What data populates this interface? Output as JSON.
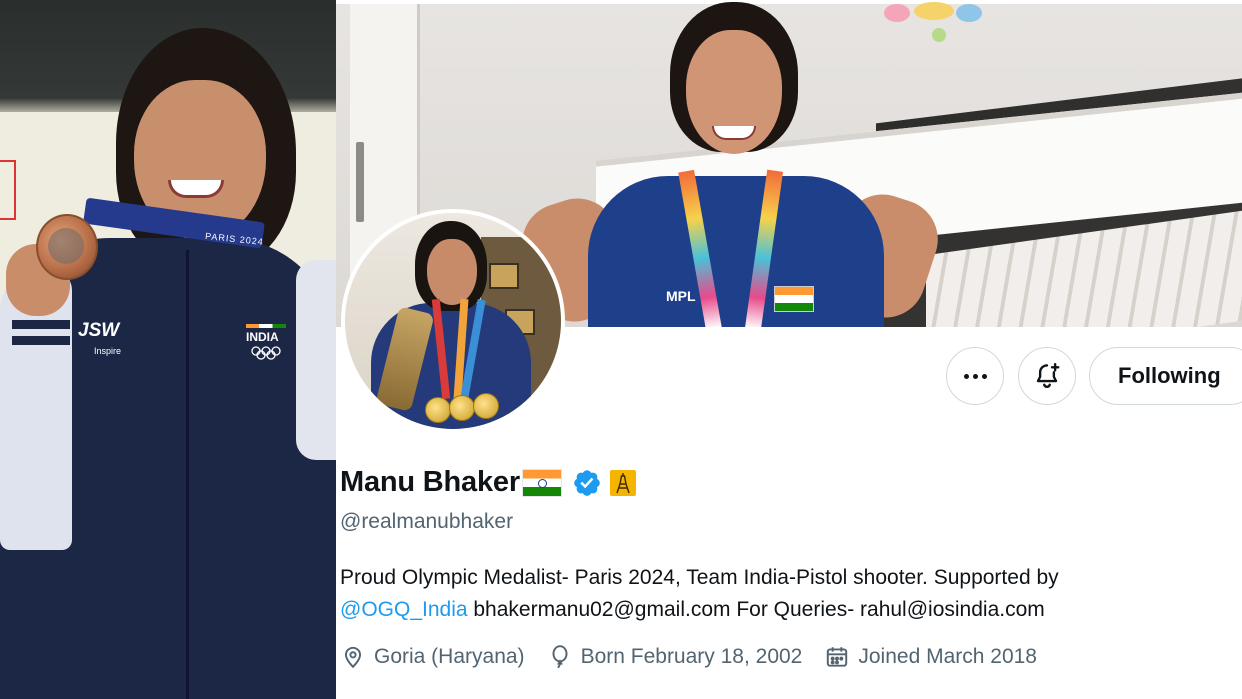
{
  "profile": {
    "name": "Manu Bhaker",
    "handle": "@realmanubhaker",
    "bio_text": "Proud Olympic Medalist- Paris 2024, Team India-Pistol shooter. Supported by",
    "bio_link": "@OGQ_India",
    "bio_text_after": " bhakermanu02@gmail.com For Queries- rahul@iosindia.com",
    "location": "Goria (Haryana)",
    "birthday": "Born February 18, 2002",
    "joined": "Joined March 2018"
  },
  "actions": {
    "following_label": "Following"
  },
  "photo": {
    "jacket_brand": "JSW",
    "jacket_brand_sub": "Inspire",
    "jacket_badge": "INDIA",
    "ribbon_text": "PARIS 2024",
    "banner_jersey_text": "MPL"
  },
  "icons": {
    "more": "more-horizontal-icon",
    "notify": "bell-plus-icon",
    "verified": "verified-badge-icon",
    "affiliate": "eiffel-tower-icon",
    "location": "map-pin-icon",
    "birthday": "balloon-icon",
    "joined": "calendar-icon"
  },
  "colors": {
    "accent": "#1d9bf0",
    "text_primary": "#0f1419",
    "text_secondary": "#536471",
    "border": "#cfd9de",
    "affiliate_badge": "#f4b400"
  }
}
